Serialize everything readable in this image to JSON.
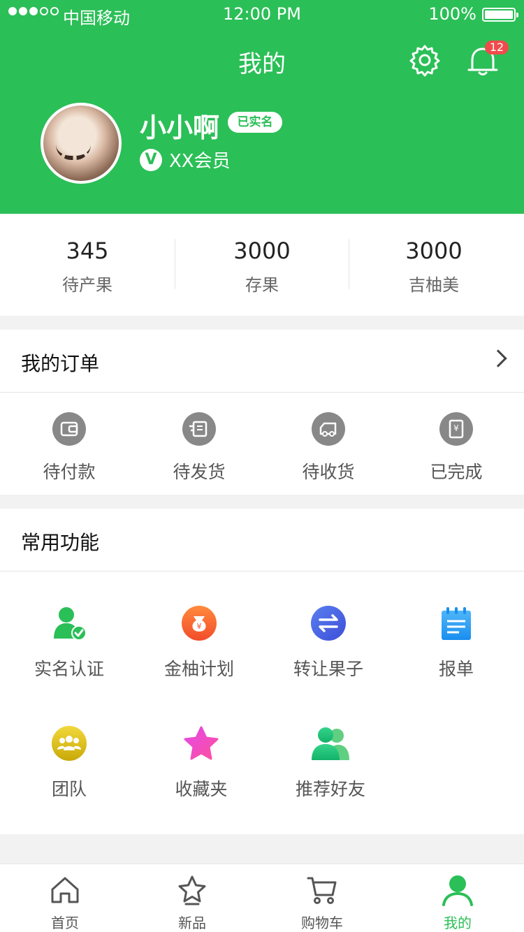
{
  "status_bar": {
    "carrier": "中国移动",
    "time": "12:00 PM",
    "battery": "100%"
  },
  "header": {
    "title": "我的",
    "notification_count": "12"
  },
  "profile": {
    "name": "小小啊",
    "verified_badge": "已实名",
    "member_level": "XX会员"
  },
  "stats": [
    {
      "value": "345",
      "label": "待产果"
    },
    {
      "value": "3000",
      "label": "存果"
    },
    {
      "value": "3000",
      "label": "吉柚美"
    }
  ],
  "orders": {
    "title": "我的订单",
    "items": [
      {
        "label": "待付款",
        "icon": "wallet-icon"
      },
      {
        "label": "待发货",
        "icon": "shipment-icon"
      },
      {
        "label": "待收货",
        "icon": "truck-icon"
      },
      {
        "label": "已完成",
        "icon": "receipt-icon"
      }
    ]
  },
  "features": {
    "title": "常用功能",
    "items": [
      {
        "label": "实名认证",
        "icon": "verified-user-icon"
      },
      {
        "label": "金柚计划",
        "icon": "money-bag-icon"
      },
      {
        "label": "转让果子",
        "icon": "transfer-icon"
      },
      {
        "label": "报单",
        "icon": "notepad-icon"
      },
      {
        "label": "团队",
        "icon": "team-icon"
      },
      {
        "label": "收藏夹",
        "icon": "star-icon"
      },
      {
        "label": "推荐好友",
        "icon": "friends-icon"
      }
    ]
  },
  "tabbar": {
    "items": [
      {
        "label": "首页",
        "icon": "home-icon"
      },
      {
        "label": "新品",
        "icon": "star-outline-icon"
      },
      {
        "label": "购物车",
        "icon": "cart-icon"
      },
      {
        "label": "我的",
        "icon": "profile-icon"
      }
    ],
    "active_index": 3
  },
  "colors": {
    "brand": "#2bbf57",
    "badge": "#f04b4b",
    "order_icon": "#888888"
  }
}
